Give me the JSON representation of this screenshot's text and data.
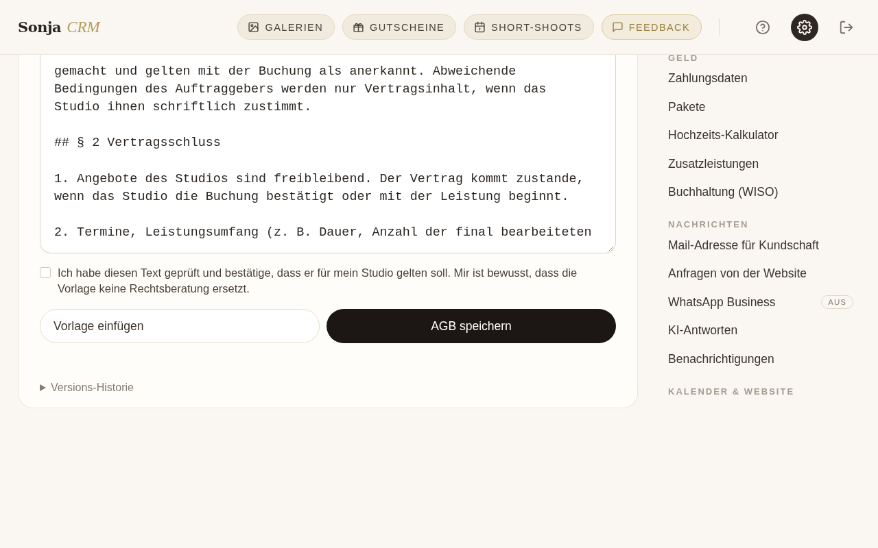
{
  "header": {
    "logo": {
      "name": "Sonja",
      "suffix": "CRM"
    },
    "nav": [
      {
        "label": "GALERIEN",
        "kind": "plain"
      },
      {
        "label": "GUTSCHEINE",
        "kind": "plain"
      },
      {
        "label": "SHORT-SHOOTS",
        "kind": "plain"
      },
      {
        "label": "FEEDBACK",
        "kind": "accent"
      }
    ],
    "actions": [
      {
        "selected": false
      },
      {
        "selected": true
      },
      {
        "selected": false
      }
    ]
  },
  "editor": {
    "text": "gemacht und gelten mit der Buchung als anerkannt. Abweichende\nBedingungen des Auftraggebers werden nur Vertragsinhalt, wenn das\nStudio ihnen schriftlich zustimmt.\n\n## § 2 Vertragsschluss\n\n1. Angebote des Studios sind freibleibend. Der Vertrag kommt zustande,\nwenn das Studio die Buchung bestätigt oder mit der Leistung beginnt.\n\n2. Termine, Leistungsumfang (z. B. Dauer, Anzahl der final bearbeiteten",
    "confirm": {
      "label": "Ich habe diesen Text geprüft und bestätige, dass er für mein Studio gelten soll. Mir ist bewusst, dass die Vorlage keine Rechtsberatung ersetzt.",
      "checked": false
    },
    "buttons": [
      {
        "label": "Vorlage einfügen",
        "kind": "secondary"
      },
      {
        "label": "AGB speichern",
        "kind": "primary"
      }
    ],
    "history": {
      "label": "Versions-Historie",
      "expanded": false
    }
  },
  "sidebar": {
    "sections": [
      {
        "title": "GELD",
        "items": [
          {
            "label": "Zahlungsdaten"
          },
          {
            "label": "Pakete"
          },
          {
            "label": "Hochzeits-Kalkulator"
          },
          {
            "label": "Zusatzleistungen"
          },
          {
            "label": "Buchhaltung (WISO)"
          }
        ]
      },
      {
        "title": "NACHRICHTEN",
        "items": [
          {
            "label": "Mail-Adresse für Kundschaft"
          },
          {
            "label": "Anfragen von der Website"
          },
          {
            "label": "WhatsApp Business",
            "badge": "AUS"
          },
          {
            "label": "KI-Antworten"
          },
          {
            "label": "Benachrichtigungen"
          }
        ]
      },
      {
        "title": "KALENDER & WEBSITE"
      }
    ]
  }
}
